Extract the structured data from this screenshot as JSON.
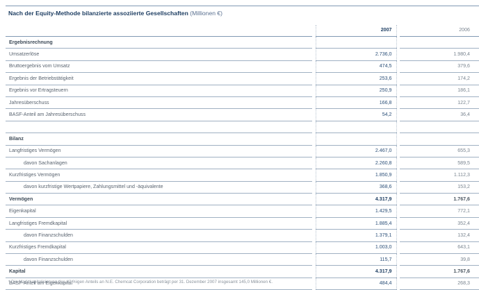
{
  "title": {
    "main": "Nach der Equity-Methode bilanzierte assoziierte Gesellschaften",
    "unit": "(Millionen €)"
  },
  "columns": {
    "year_current": "2007",
    "year_prior": "2006"
  },
  "rows": [
    {
      "type": "section",
      "label": "Ergebnisrechnung"
    },
    {
      "type": "row",
      "label": "Umsatzerlöse",
      "v2007": "2.736,0",
      "v2006": "1.980,4"
    },
    {
      "type": "row",
      "label": "Bruttoergebnis vom Umsatz",
      "v2007": "474,5",
      "v2006": "379,6"
    },
    {
      "type": "row",
      "label": "Ergebnis der Betriebstätigkeit",
      "v2007": "253,6",
      "v2006": "174,2"
    },
    {
      "type": "row",
      "label": "Ergebnis vor Ertragsteuern",
      "v2007": "250,9",
      "v2006": "186,1"
    },
    {
      "type": "row",
      "label": "Jahresüberschuss",
      "v2007": "166,8",
      "v2006": "122,7"
    },
    {
      "type": "row",
      "label": "BASF-Anteil am Jahresüberschuss",
      "v2007": "54,2",
      "v2006": "36,4"
    },
    {
      "type": "spacer"
    },
    {
      "type": "section",
      "label": "Bilanz"
    },
    {
      "type": "row",
      "label": "Langfristiges Vermögen",
      "v2007": "2.467,0",
      "v2006": "655,3"
    },
    {
      "type": "row",
      "indent": true,
      "label": "davon Sachanlagen",
      "v2007": "2.260,8",
      "v2006": "589,5"
    },
    {
      "type": "row",
      "label": "Kurzfristiges Vermögen",
      "v2007": "1.850,9",
      "v2006": "1.112,3"
    },
    {
      "type": "row",
      "indent": true,
      "label": "davon kurzfristige Wertpapiere, Zahlungsmittel und -äquivalente",
      "v2007": "368,6",
      "v2006": "153,2"
    },
    {
      "type": "bold",
      "label": "Vermögen",
      "v2007": "4.317,9",
      "v2006": "1.767,6"
    },
    {
      "type": "row",
      "label": "Eigenkapital",
      "v2007": "1.429,5",
      "v2006": "772,1"
    },
    {
      "type": "row",
      "label": "Langfristiges Fremdkapital",
      "v2007": "1.885,4",
      "v2006": "352,4"
    },
    {
      "type": "row",
      "indent": true,
      "label": "davon Finanzschulden",
      "v2007": "1.379,1",
      "v2006": "132,4"
    },
    {
      "type": "row",
      "label": "Kurzfristiges Fremdkapital",
      "v2007": "1.003,0",
      "v2006": "643,1"
    },
    {
      "type": "row",
      "indent": true,
      "label": "davon Finanzschulden",
      "v2007": "115,7",
      "v2006": "39,8"
    },
    {
      "type": "bold",
      "label": "Kapital",
      "v2007": "4.317,9",
      "v2006": "1.767,6"
    },
    {
      "type": "row",
      "label": "BASF-Anteil am Eigenkapital",
      "v2007": "484,4",
      "v2006": "268,3"
    }
  ],
  "footnote": "* Die Marktkapitalisierung des 42 %igen Anteils an N.E. Chemcat Corporation beträgt per 31. Dezember 2007 insgesamt 145,0 Millionen €."
}
